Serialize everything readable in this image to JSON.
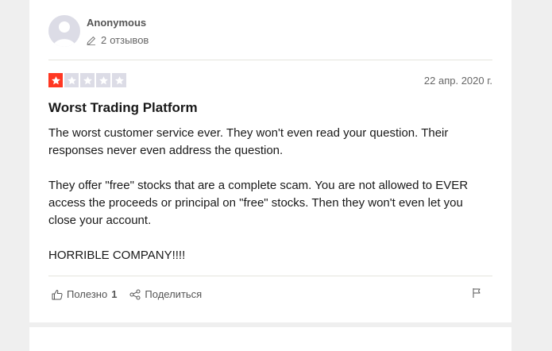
{
  "review": {
    "consumer": {
      "name": "Anonymous",
      "reviews_count": "2",
      "reviews_label": "отзывов"
    },
    "rating": 1,
    "rating_max": 5,
    "date": "22 апр. 2020 г.",
    "title": "Worst Trading Platform",
    "paragraphs": [
      "The worst customer service ever. They won't even read your question. Their responses never even address the question.",
      "They offer \"free\" stocks that are a complete scam. You are not allowed to EVER access the proceeds or principal on \"free\" stocks. Then they won't even let you close your account.",
      "HORRIBLE COMPANY!!!!"
    ]
  },
  "actions": {
    "useful_label": "Полезно",
    "useful_count": "1",
    "share_label": "Поделиться"
  },
  "colors": {
    "star_filled": "#ff3722",
    "star_empty": "#dcdce6",
    "page_background": "#efefef",
    "card_background": "#ffffff"
  },
  "icons": [
    "avatar-placeholder-icon",
    "pencil-icon",
    "star-icon",
    "thumbs-up-icon",
    "share-icon",
    "flag-icon"
  ]
}
